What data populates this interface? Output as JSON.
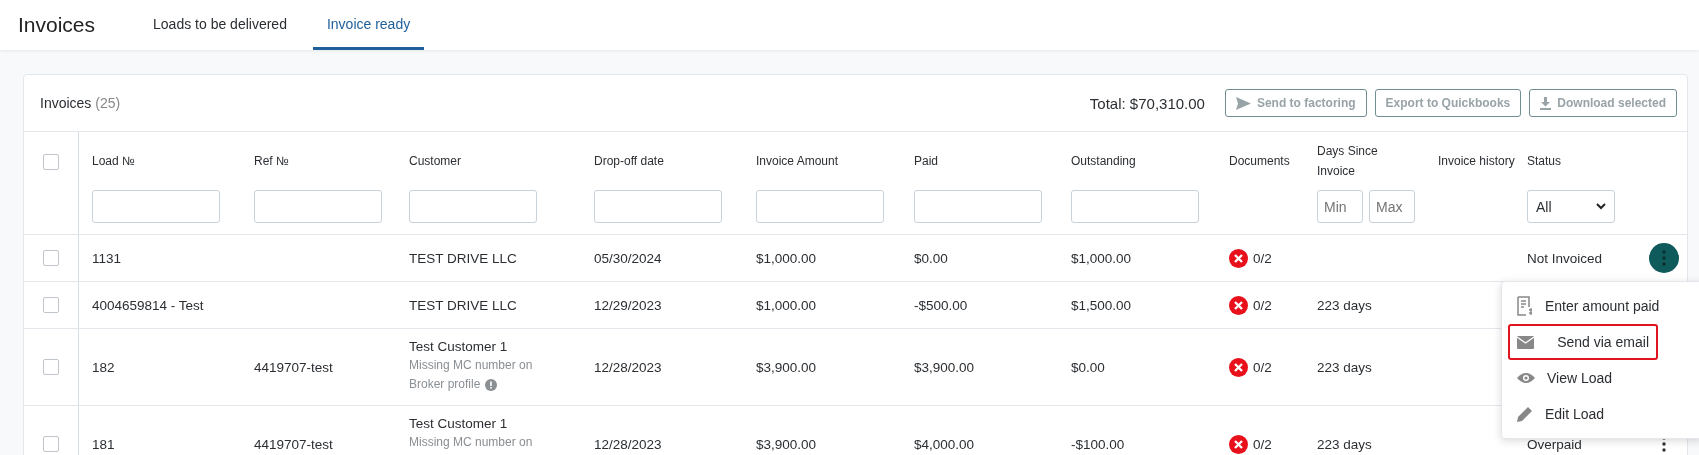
{
  "header": {
    "title": "Invoices",
    "tabs": [
      {
        "label": "Loads to be delivered",
        "selected": false
      },
      {
        "label": "Invoice ready",
        "selected": true
      }
    ]
  },
  "card": {
    "title": "Invoices",
    "count": "(25)",
    "total": "Total: $70,310.00",
    "buttons": [
      {
        "label": "Send to factoring",
        "kind": "send"
      },
      {
        "label": "Export to Quickbooks",
        "kind": "plain"
      },
      {
        "label": "Download selected",
        "kind": "download"
      }
    ]
  },
  "table": {
    "select_all_checked": false,
    "columns": [
      {
        "label": "Load №",
        "kind": "text"
      },
      {
        "label": "Ref №",
        "kind": "text"
      },
      {
        "label": "Customer",
        "kind": "text"
      },
      {
        "label": "Drop-off date",
        "kind": "text"
      },
      {
        "label": "Invoice Amount",
        "kind": "text"
      },
      {
        "label": "Paid",
        "kind": "text"
      },
      {
        "label": "Outstanding",
        "kind": "text"
      },
      {
        "label": "Documents",
        "kind": "plain"
      },
      {
        "label": "Days Since Invoice",
        "kind": "range"
      },
      {
        "label": "Invoice history",
        "kind": "plain"
      },
      {
        "label": "Status",
        "kind": "select"
      }
    ],
    "range_placeholders": [
      "Min",
      "Max"
    ],
    "status_filter": "All",
    "rows": [
      {
        "checked": false,
        "load": "1131",
        "ref": "",
        "customer": "TEST DRIVE LLC",
        "note_lines": [],
        "drop_off": "05/30/2024",
        "invoice_amount": "$1,000.00",
        "paid": "$0.00",
        "outstanding": "$1,000.00",
        "documents": "0/2",
        "days": "",
        "status": "Not Invoiced",
        "menu_open": true
      },
      {
        "checked": false,
        "load": "4004659814 - Test",
        "ref": "",
        "customer": "TEST DRIVE LLC",
        "note_lines": [],
        "drop_off": "12/29/2023",
        "invoice_amount": "$1,000.00",
        "paid": "-$500.00",
        "outstanding": "$1,500.00",
        "documents": "0/2",
        "days": "223 days",
        "status": ""
      },
      {
        "checked": false,
        "load": "182",
        "ref": "4419707-test",
        "customer": "Test Customer 1",
        "note_lines": [
          "Missing MC number on",
          "Broker profile"
        ],
        "note_info": true,
        "drop_off": "12/28/2023",
        "invoice_amount": "$3,900.00",
        "paid": "$3,900.00",
        "outstanding": "$0.00",
        "documents": "0/2",
        "days": "223 days",
        "status": ""
      },
      {
        "checked": false,
        "load": "181",
        "ref": "4419707-test",
        "customer": "Test Customer 1",
        "note_lines": [
          "Missing MC number on"
        ],
        "drop_off": "12/28/2023",
        "invoice_amount": "$3,900.00",
        "paid": "$4,000.00",
        "outstanding": "-$100.00",
        "documents": "0/2",
        "days": "223 days",
        "status": "Overpaid",
        "menu_open": false
      }
    ]
  },
  "menu": [
    {
      "label": "Enter amount paid",
      "kind": "receipt",
      "selected": false
    },
    {
      "label": "Send via email",
      "kind": "mail",
      "selected": true
    },
    {
      "label": "View Load",
      "kind": "eye",
      "selected": false
    },
    {
      "label": "Edit Load",
      "kind": "pencil",
      "selected": false
    }
  ]
}
